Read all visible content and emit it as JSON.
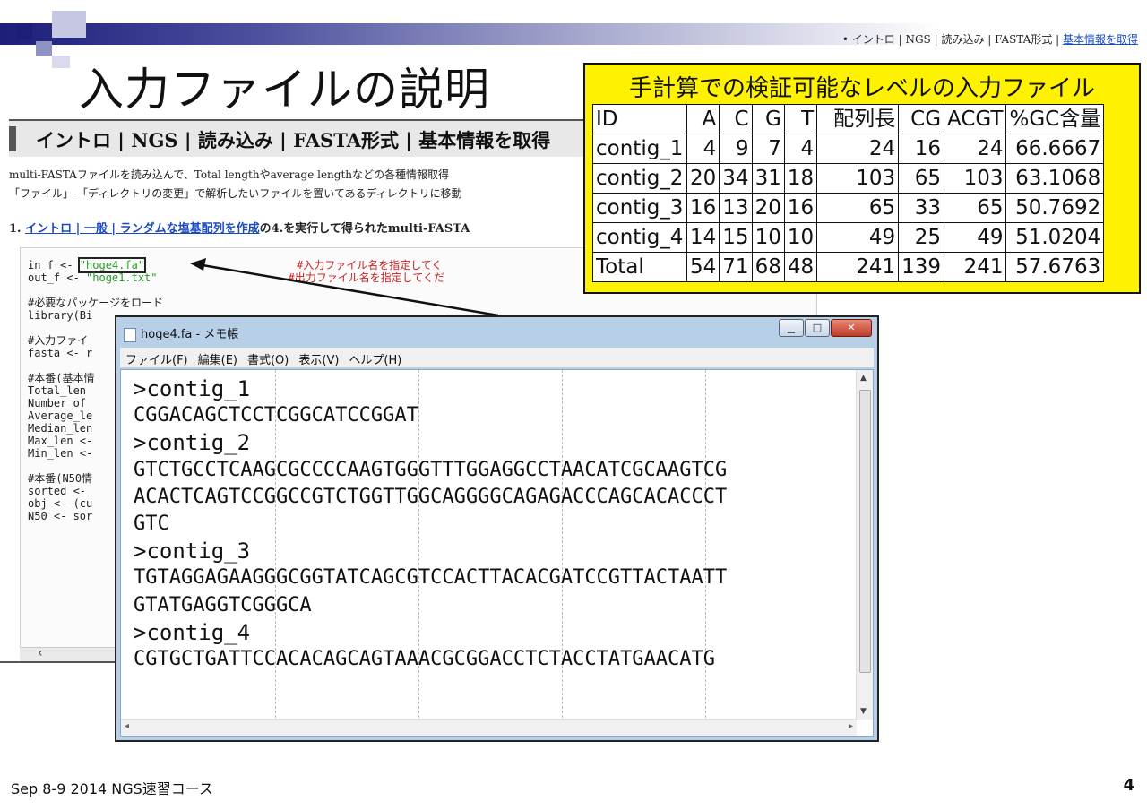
{
  "slide": {
    "title": "入力ファイルの説明",
    "breadcrumb_prefix": "• イントロ | NGS | 読み込み | FASTA形式 | ",
    "breadcrumb_link": "基本情報を取得",
    "footer": "Sep 8-9 2014 NGS速習コース",
    "page_number": "4"
  },
  "webpage": {
    "heading": "イントロ | NGS | 読み込み | FASTA形式 | 基本情報を取得",
    "line1": "multi-FASTAファイルを読み込んで、Total lengthやaverage lengthなどの各種情報取得",
    "line2": "「ファイル」-「ディレクトリの変更」で解析したいファイルを置いてあるディレクトリに移動",
    "item_prefix": "1. ",
    "item_link": "イントロ | 一般 | ランダムな塩基配列を作成",
    "item_suffix": "の4.を実行して得られたmulti-FASTA",
    "code": {
      "l1a": "in_f <- ",
      "l1b": "\"hoge4.fa\"",
      "l1c": "#入力ファイル名を指定してく",
      "l2a": "out_f <- ",
      "l2b": "\"hoge1.txt\"",
      "l2c": "#出力ファイル名を指定してくだ",
      "l3": "#必要なパッケージをロード",
      "l4": "library(Bi",
      "l5": "#入力ファイ",
      "l6": "fasta <- r",
      "l7": "#本番(基本情",
      "l8": "Total_len ",
      "l9": "Number_of_",
      "l10": "Average_le",
      "l11": "Median_len",
      "l12": "Max_len <-",
      "l13": "Min_len <-",
      "l14": "#本番(N50情",
      "l15": "sorted <- ",
      "l16": "obj <- (cu",
      "l17": "N50 <- sor"
    }
  },
  "notepad": {
    "title": "hoge4.fa - メモ帳",
    "menu": [
      "ファイル(F)",
      "編集(E)",
      "書式(O)",
      "表示(V)",
      "ヘルプ(H)"
    ],
    "lines": [
      ">contig_1",
      "CGGACAGCTCCTCGGCATCCGGAT",
      ">contig_2",
      "GTCTGCCTCAAGCGCCCCAAGTGGGTTTGGAGGCCTAACATCGCAAGTCG",
      "ACACTCAGTCCGGCCGTCTGGTTGGCAGGGGCAGAGACCCAGCACACCCT",
      "GTC",
      ">contig_3",
      "TGTAGGAGAAGGGCGGTATCAGCGTCCACTTACACGATCCGTTACTAATT",
      "GTATGAGGTCGGGCA",
      ">contig_4",
      "CGTGCTGATTCCACACAGCAGTAAACGCGGACCTCTACCTATGAACATG"
    ]
  },
  "callout": {
    "title": "手計算での検証可能なレベルの入力ファイル",
    "headers": [
      "ID",
      "A",
      "C",
      "G",
      "T",
      "配列長",
      "CG",
      "ACGT",
      "%GC含量"
    ],
    "rows": [
      [
        "contig_1",
        "4",
        "9",
        "7",
        "4",
        "24",
        "16",
        "24",
        "66.6667"
      ],
      [
        "contig_2",
        "20",
        "34",
        "31",
        "18",
        "103",
        "65",
        "103",
        "63.1068"
      ],
      [
        "contig_3",
        "16",
        "13",
        "20",
        "16",
        "65",
        "33",
        "65",
        "50.7692"
      ],
      [
        "contig_4",
        "14",
        "15",
        "10",
        "10",
        "49",
        "25",
        "49",
        "51.0204"
      ],
      [
        "Total",
        "54",
        "71",
        "68",
        "48",
        "241",
        "139",
        "241",
        "57.6763"
      ]
    ]
  }
}
